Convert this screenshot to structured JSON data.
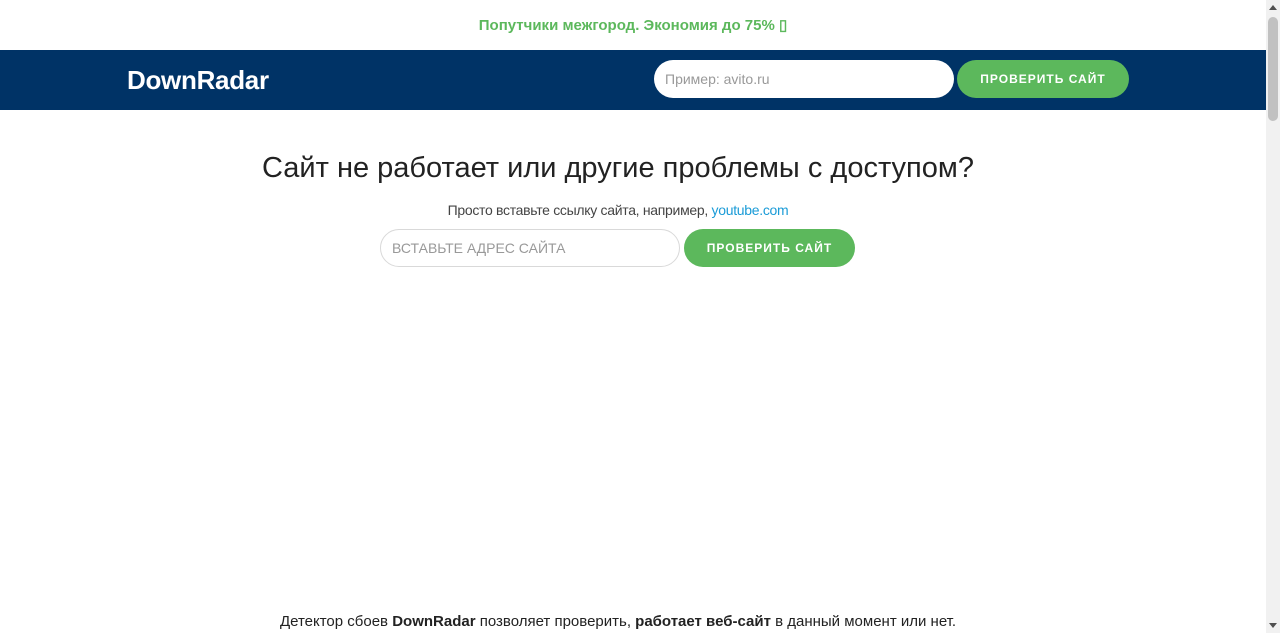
{
  "promo": {
    "text": "Попутчики межгород. Экономия до 75% ",
    "icon_glyph": "▯",
    "color": "#5cb85c"
  },
  "header": {
    "logo": "DownRadar",
    "search_placeholder": "Пример: avito.ru",
    "check_button": "Проверить сайт",
    "background": "#003366"
  },
  "hero": {
    "title": "Сайт не работает или другие проблемы с доступом?",
    "subtitle_prefix": "Просто вставьте ссылку сайта, например, ",
    "subtitle_link": "youtube.com",
    "input_placeholder": "Вставьте адрес сайта",
    "check_button": "Проверить сайт"
  },
  "footer": {
    "part1": "Детектор сбоев ",
    "bold1": "DownRadar",
    "part2": " позволяет проверить, ",
    "bold2": "работает веб-сайт",
    "part3": " в данный момент или нет."
  },
  "colors": {
    "accent_green": "#5cb85c",
    "link_blue": "#1a9bd7",
    "header_navy": "#003366"
  }
}
